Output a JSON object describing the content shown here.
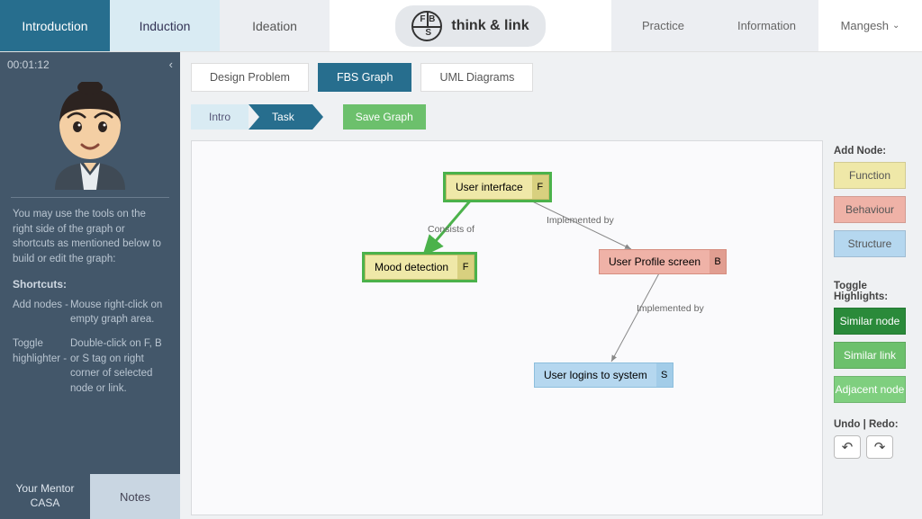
{
  "brand": {
    "name": "think & link"
  },
  "topnav": {
    "introduction": "Introduction",
    "induction": "Induction",
    "ideation": "Ideation",
    "practice": "Practice",
    "information": "Information",
    "user": "Mangesh"
  },
  "sidebar": {
    "timer": "00:01:12",
    "intro_text": "You may use the tools on the right side of the graph or shortcuts as mentioned below to build or edit the graph:",
    "shortcuts_heading": "Shortcuts:",
    "shortcuts": {
      "add_nodes_k": "Add nodes -",
      "add_nodes_v": "Mouse right-click on empty graph area.",
      "toggle_k": "Toggle highlighter -",
      "toggle_v": "Double-click on F, B or S tag on right corner of selected node or link."
    },
    "footer_a_line1": "Your Mentor",
    "footer_a_line2": "CASA",
    "footer_b": "Notes"
  },
  "subtabs": {
    "design_problem": "Design Problem",
    "fbs_graph": "FBS Graph",
    "uml_diagrams": "UML Diagrams"
  },
  "breadcrumb": {
    "intro": "Intro",
    "task": "Task"
  },
  "actions": {
    "save_graph": "Save Graph"
  },
  "tools": {
    "add_node_heading": "Add Node:",
    "function": "Function",
    "behaviour": "Behaviour",
    "structure": "Structure",
    "toggle_heading": "Toggle Highlights:",
    "similar_node": "Similar node",
    "similar_link": "Similar link",
    "adjacent_node": "Adjacent node",
    "undoredo_heading": "Undo | Redo:"
  },
  "graph": {
    "nodes": {
      "user_interface": {
        "label": "User interface",
        "tag": "F"
      },
      "mood_detection": {
        "label": "Mood detection",
        "tag": "F"
      },
      "user_profile": {
        "label": "User Profile screen",
        "tag": "B"
      },
      "user_logins": {
        "label": "User logins to system",
        "tag": "S"
      }
    },
    "edges": {
      "consists_of": "Consists of",
      "implemented_by_1": "Implemented by",
      "implemented_by_2": "Implemented by"
    }
  }
}
